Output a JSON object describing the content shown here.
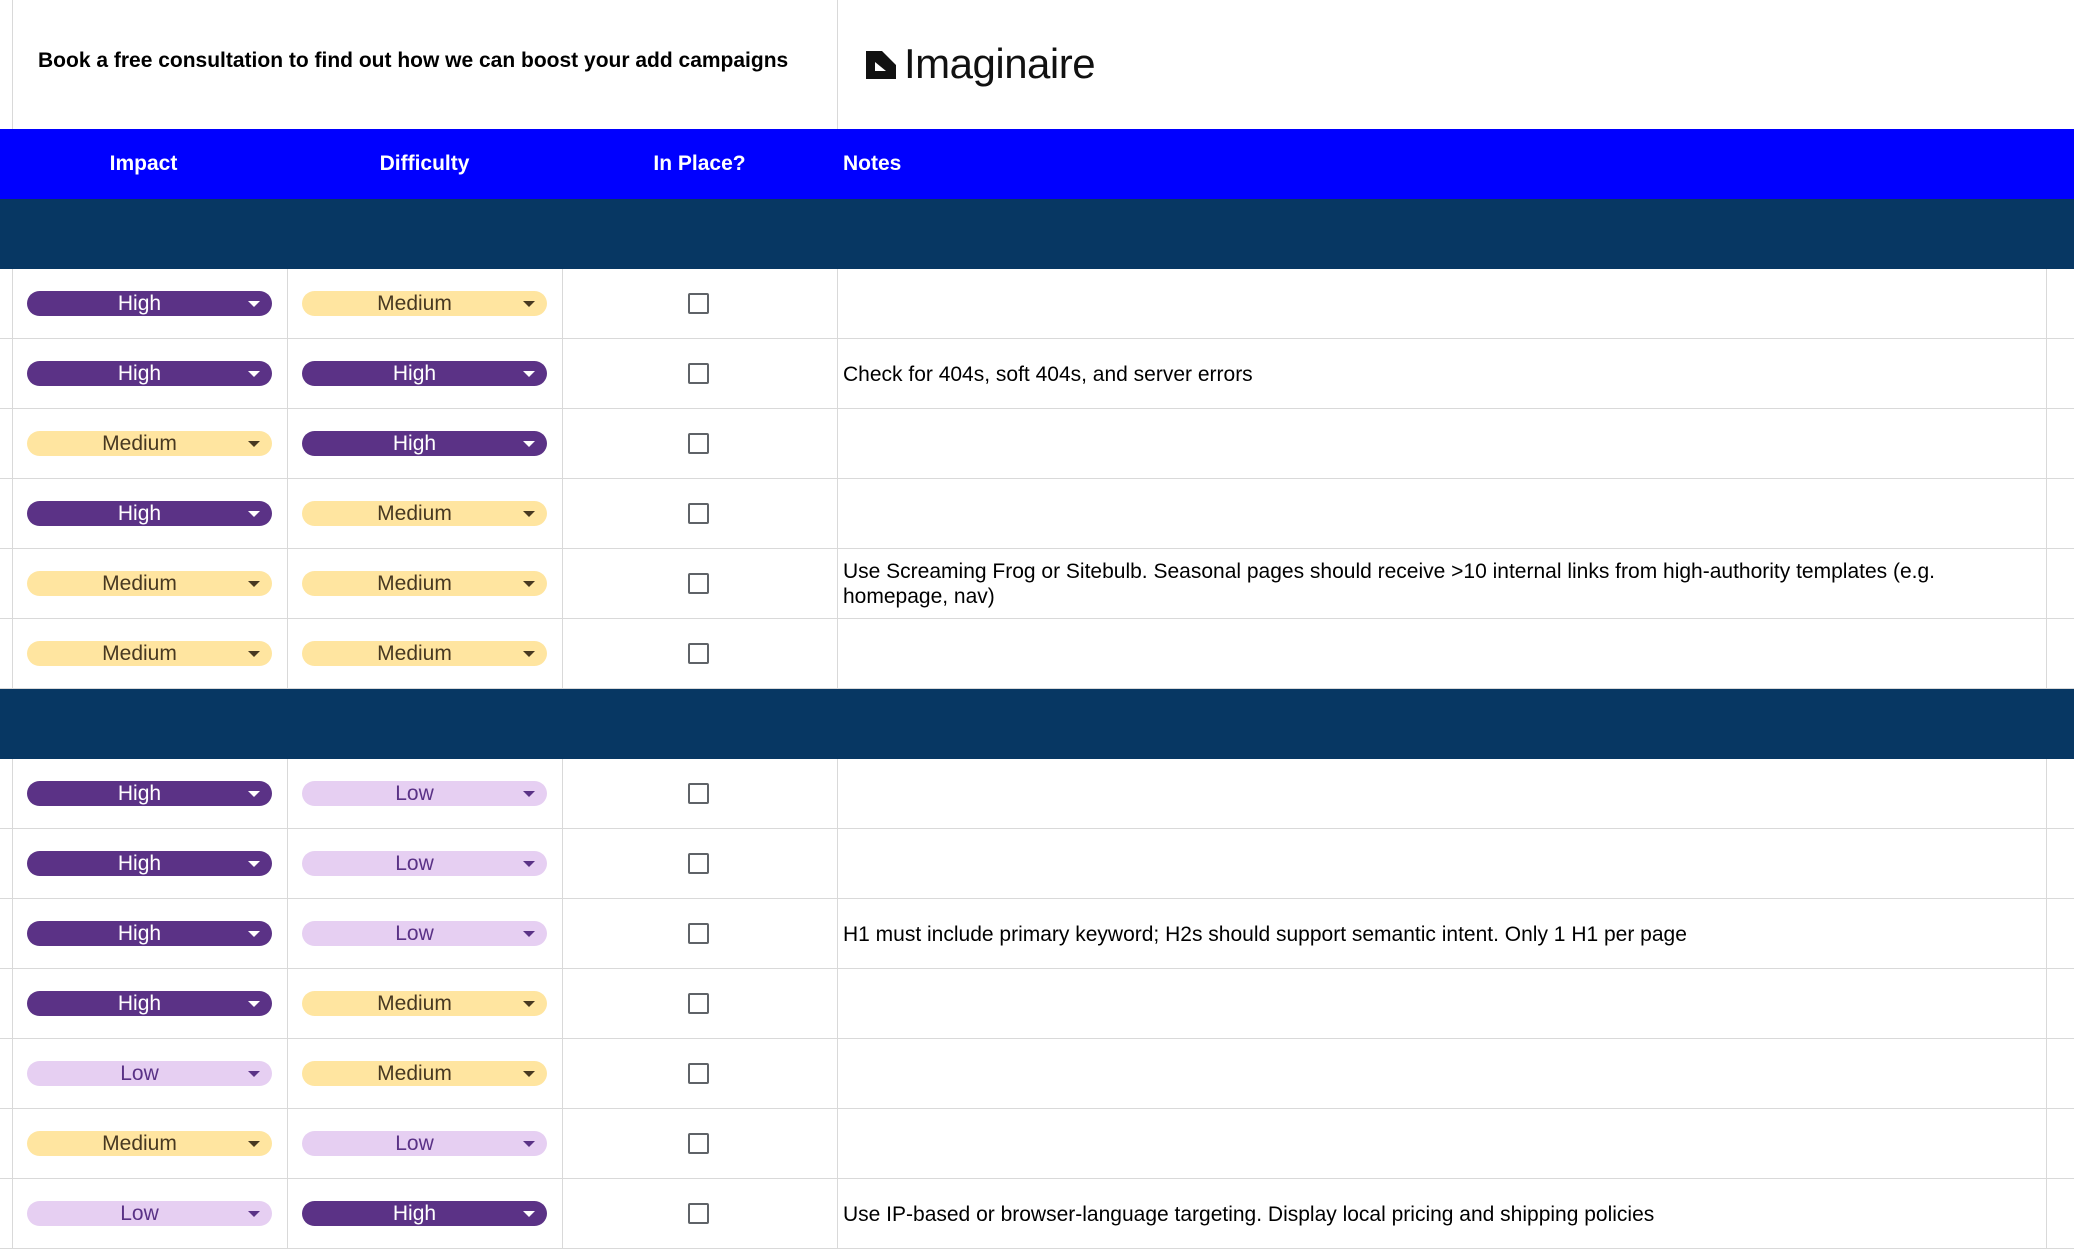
{
  "promo_text": "Book a free consultation to find out how we can boost your add campaigns",
  "brand": {
    "name": "Imaginaire",
    "header_color": "#0000ff",
    "section_color": "#073763"
  },
  "columns": {
    "impact": "Impact",
    "difficulty": "Difficulty",
    "in_place": "In Place?",
    "notes": "Notes"
  },
  "levels": {
    "High": "#5b3286",
    "Medium": "#ffe5a0",
    "Low": "#e6cff2"
  },
  "groups": [
    {
      "rows": [
        {
          "impact": "High",
          "difficulty": "Medium",
          "in_place": false,
          "note": ""
        },
        {
          "impact": "High",
          "difficulty": "High",
          "in_place": false,
          "note": "Check for 404s, soft 404s, and server errors"
        },
        {
          "impact": "Medium",
          "difficulty": "High",
          "in_place": false,
          "note": ""
        },
        {
          "impact": "High",
          "difficulty": "Medium",
          "in_place": false,
          "note": ""
        },
        {
          "impact": "Medium",
          "difficulty": "Medium",
          "in_place": false,
          "note": "Use Screaming Frog or Sitebulb. Seasonal pages should receive >10 internal links from high-authority templates (e.g. homepage, nav)"
        },
        {
          "impact": "Medium",
          "difficulty": "Medium",
          "in_place": false,
          "note": ""
        }
      ]
    },
    {
      "rows": [
        {
          "impact": "High",
          "difficulty": "Low",
          "in_place": false,
          "note": ""
        },
        {
          "impact": "High",
          "difficulty": "Low",
          "in_place": false,
          "note": ""
        },
        {
          "impact": "High",
          "difficulty": "Low",
          "in_place": false,
          "note": "H1 must include primary keyword; H2s should support semantic intent. Only 1 H1 per page"
        },
        {
          "impact": "High",
          "difficulty": "Medium",
          "in_place": false,
          "note": ""
        },
        {
          "impact": "Low",
          "difficulty": "Medium",
          "in_place": false,
          "note": ""
        },
        {
          "impact": "Medium",
          "difficulty": "Low",
          "in_place": false,
          "note": ""
        },
        {
          "impact": "Low",
          "difficulty": "High",
          "in_place": false,
          "note": "Use IP-based or browser-language targeting. Display local pricing and shipping policies"
        }
      ]
    }
  ]
}
